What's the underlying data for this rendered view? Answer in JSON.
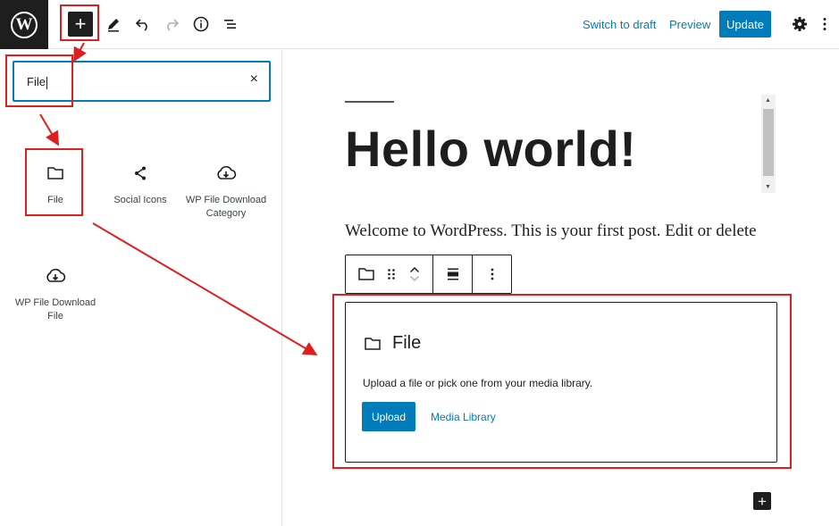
{
  "toolbar": {
    "logo_letter": "W",
    "inserter_symbol": "+",
    "switch_to_draft": "Switch to draft",
    "preview": "Preview",
    "update": "Update"
  },
  "inserter": {
    "search_value": "File",
    "clear_symbol": "×",
    "results": [
      {
        "label": "File",
        "icon": "folder-icon"
      },
      {
        "label": "Social Icons",
        "icon": "share-icon"
      },
      {
        "label": "WP File Download Category",
        "icon": "cloud-download-icon"
      },
      {
        "label": "WP File Download File",
        "icon": "cloud-download-icon"
      }
    ]
  },
  "editor": {
    "title": "Hello world!",
    "paragraph": "Welcome to WordPress. This is your first post. Edit or delete",
    "file_block": {
      "title": "File",
      "instructions": "Upload a file or pick one from your media library.",
      "upload": "Upload",
      "media_library": "Media Library"
    },
    "add_block_symbol": "+"
  },
  "colors": {
    "accent": "#007cba",
    "dark": "#1e1e1e",
    "annotation": "#e01e1e"
  }
}
